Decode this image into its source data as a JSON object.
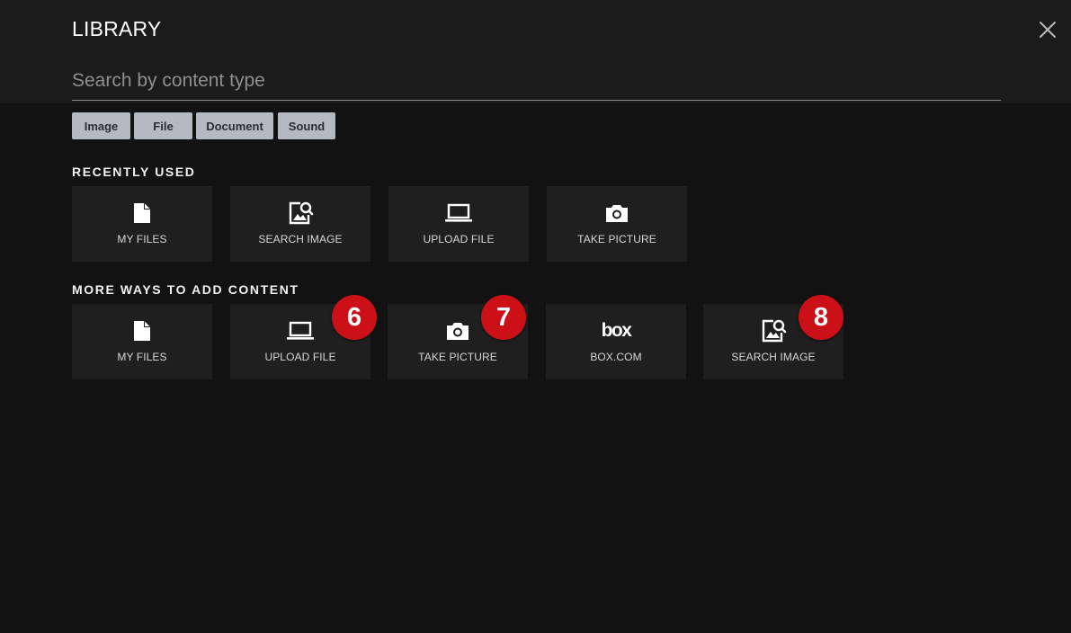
{
  "header": {
    "title": "LIBRARY",
    "close_icon": "close-icon"
  },
  "search": {
    "placeholder": "Search by content type",
    "value": ""
  },
  "filters": [
    "Image",
    "File",
    "Document",
    "Sound"
  ],
  "recently_used": {
    "title": "RECENTLY USED",
    "items": [
      {
        "label": "MY FILES",
        "icon": "file-icon"
      },
      {
        "label": "SEARCH IMAGE",
        "icon": "image-search-icon"
      },
      {
        "label": "UPLOAD FILE",
        "icon": "laptop-icon"
      },
      {
        "label": "TAKE PICTURE",
        "icon": "camera-icon"
      }
    ]
  },
  "more_ways": {
    "title": "MORE WAYS TO ADD CONTENT",
    "items": [
      {
        "label": "MY FILES",
        "icon": "file-icon"
      },
      {
        "label": "UPLOAD FILE",
        "icon": "laptop-icon"
      },
      {
        "label": "TAKE PICTURE",
        "icon": "camera-icon"
      },
      {
        "label": "BOX.COM",
        "icon": "box-logo-icon",
        "logo_text": "box"
      },
      {
        "label": "SEARCH IMAGE",
        "icon": "image-search-icon"
      }
    ]
  },
  "badges": [
    "6",
    "7",
    "8"
  ],
  "colors": {
    "background": "#121213",
    "header": "#1b1b1c",
    "tile": "#1f1f20",
    "chip": "#b4b9c2",
    "badge": "#cc1017"
  }
}
